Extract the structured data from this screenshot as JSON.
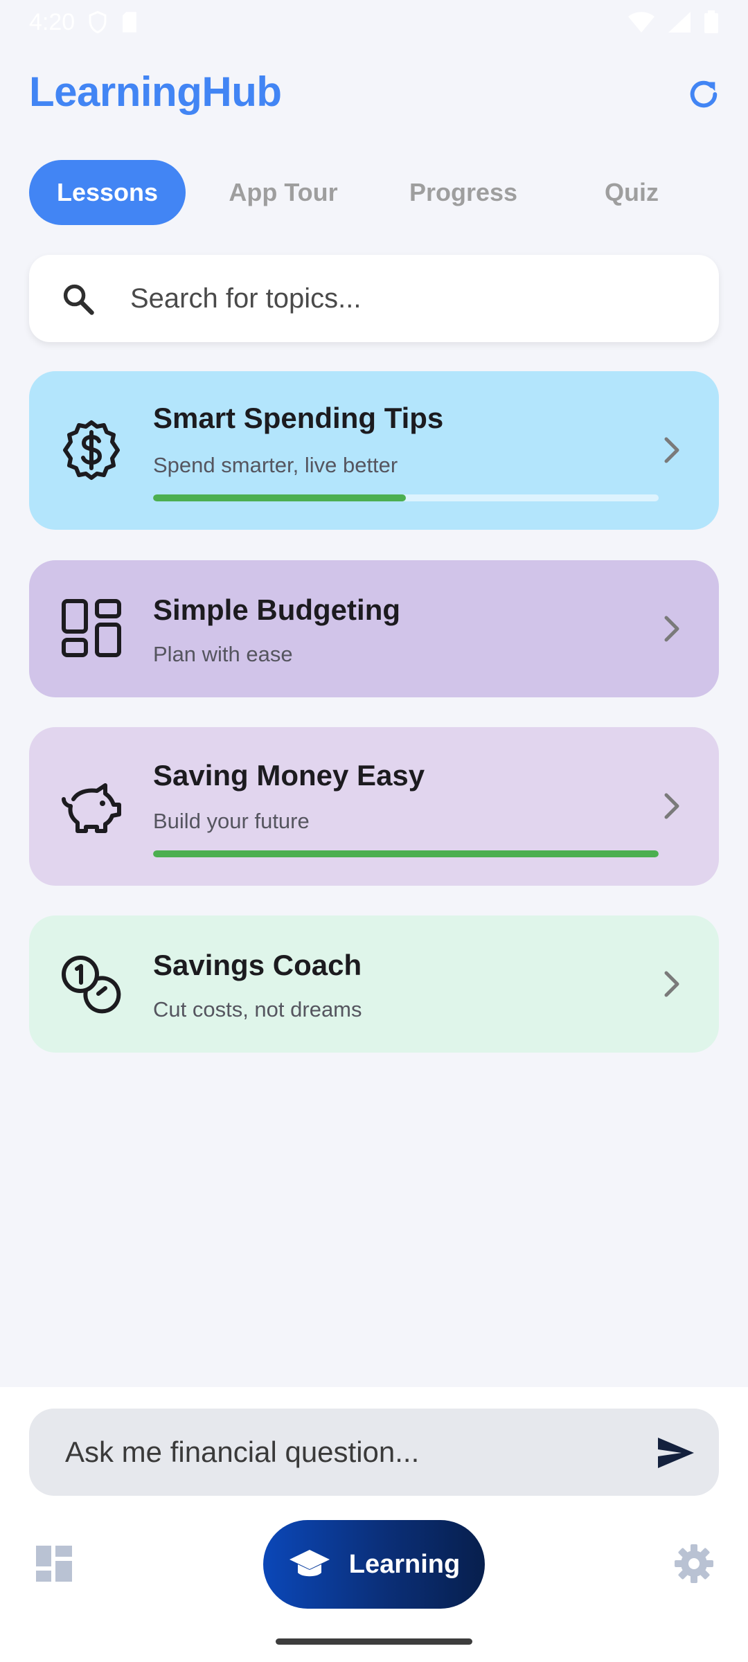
{
  "status": {
    "time": "4:20"
  },
  "app": {
    "title": "LearningHub"
  },
  "tabs": [
    {
      "label": "Lessons",
      "active": true
    },
    {
      "label": "App Tour",
      "active": false
    },
    {
      "label": "Progress",
      "active": false
    },
    {
      "label": "Quiz",
      "active": false
    }
  ],
  "search": {
    "placeholder": "Search for topics..."
  },
  "lessons": [
    {
      "title": "Smart Spending Tips",
      "subtitle": "Spend smarter, live better",
      "icon": "dollar-badge-icon",
      "color": "#b3e5fc",
      "progress": 0.5
    },
    {
      "title": "Simple Budgeting",
      "subtitle": "Plan with ease",
      "icon": "dashboard-grid-icon",
      "color": "#d1c4e9",
      "progress": null
    },
    {
      "title": "Saving Money Easy",
      "subtitle": "Build your future",
      "icon": "piggy-bank-icon",
      "color": "#e1d5ee",
      "progress": 1.0
    },
    {
      "title": "Savings Coach",
      "subtitle": "Cut costs, not dreams",
      "icon": "coins-icon",
      "color": "#dff5ea",
      "progress": null
    }
  ],
  "chat": {
    "placeholder": "Ask me financial question..."
  },
  "bottom_nav": {
    "left_icon": "dashboard-icon",
    "center_label": "Learning",
    "center_icon": "graduation-cap-icon",
    "right_icon": "settings-icon"
  },
  "colors": {
    "accent": "#4285f4",
    "progress": "#4caf50",
    "background": "#f4f5fa",
    "nav_gradient_start": "#0b47b8",
    "nav_gradient_end": "#071f4d"
  }
}
